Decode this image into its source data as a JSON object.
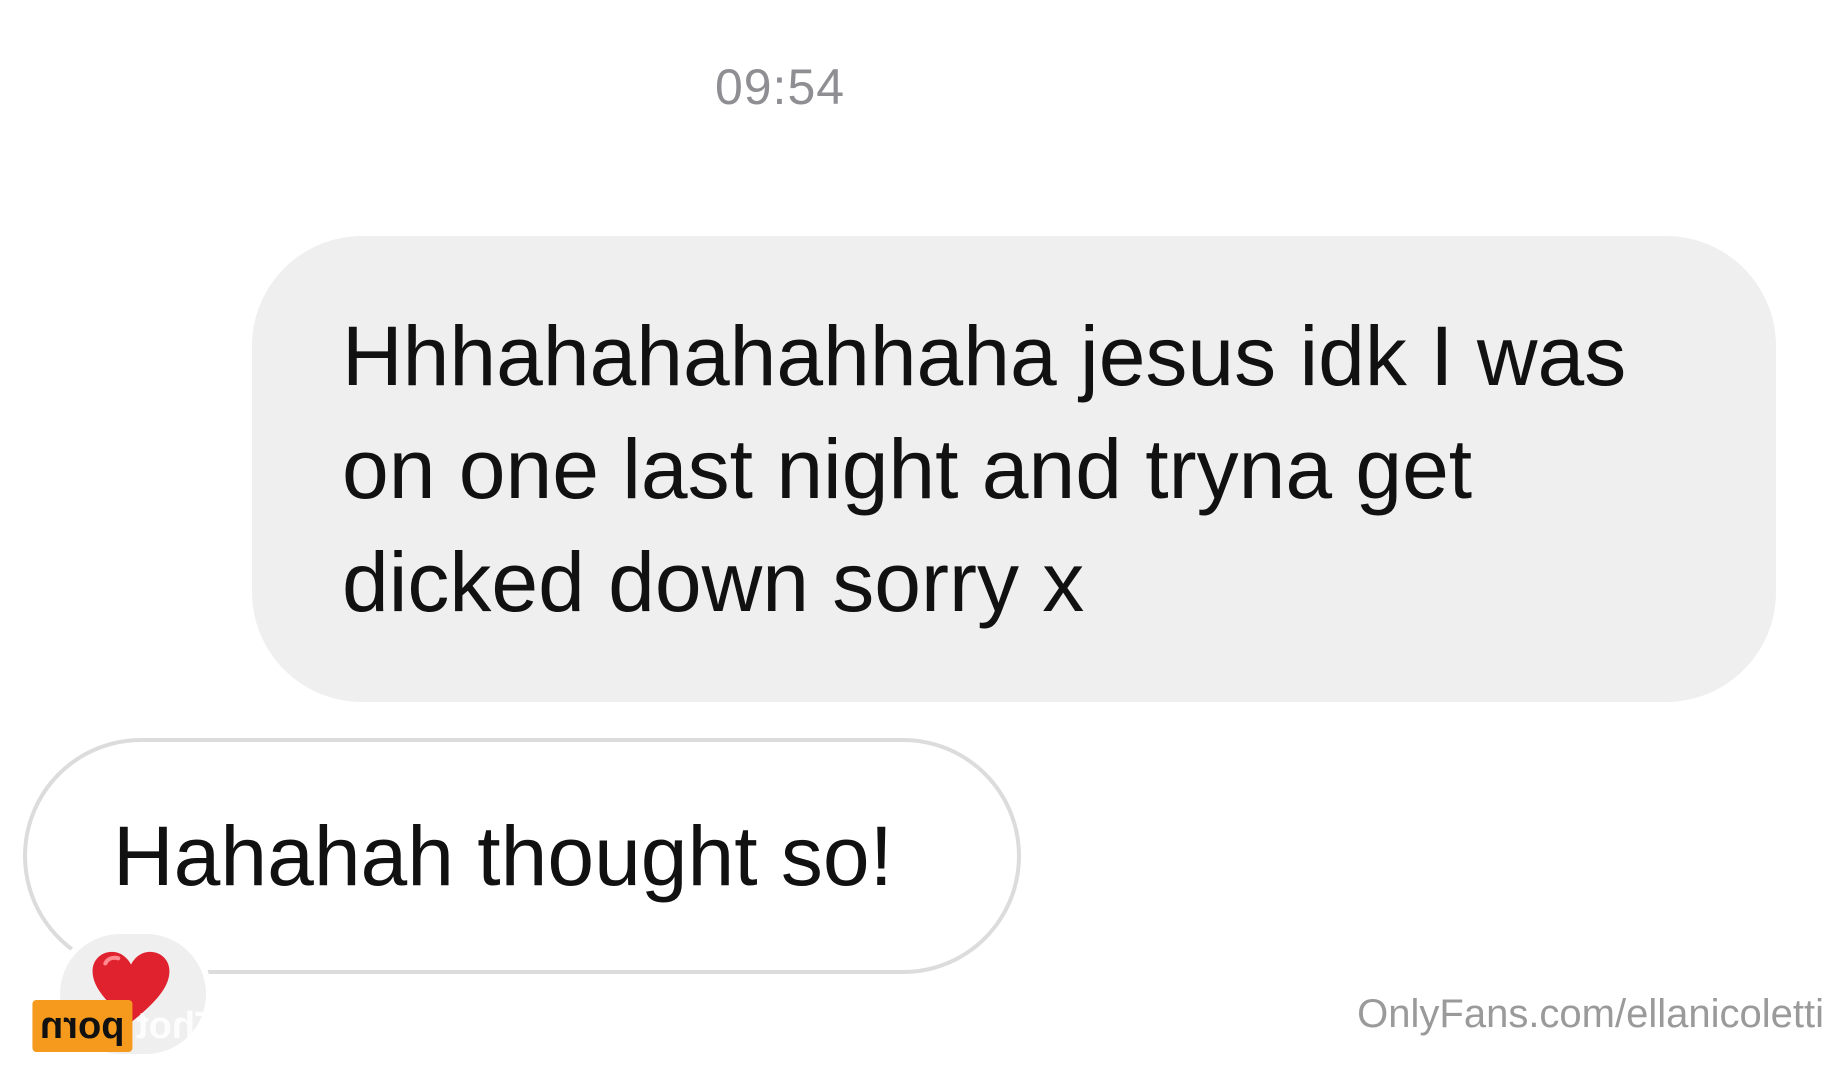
{
  "conversation": {
    "timestamp": "09:54",
    "messages": [
      {
        "side": "received",
        "text": "Hhhahahahahhaha jesus idk I was on one last night and tryna get dicked down sorry x"
      },
      {
        "side": "sent",
        "text": "Hahahah thought so!",
        "reaction": "heart"
      }
    ]
  },
  "watermark": {
    "logo_badge": "porn",
    "logo_word": "Thot",
    "credit": "OnlyFans.com/ellanicoletti"
  },
  "colors": {
    "received_bubble": "#efefef",
    "sent_bubble_border": "#dcdcdc",
    "timestamp": "#8e8e93",
    "heart": "#e0222e",
    "logo_badge": "#f59a1c"
  }
}
